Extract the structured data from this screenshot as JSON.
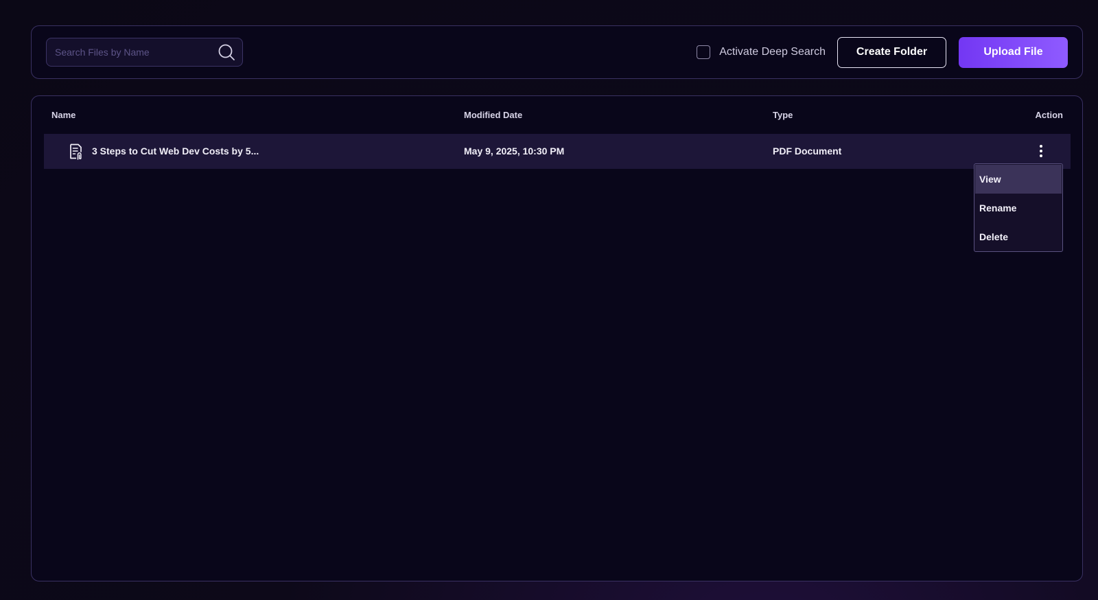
{
  "toolbar": {
    "search_placeholder": "Search Files by Name",
    "deep_search_label": "Activate Deep Search",
    "deep_search_checked": false,
    "create_folder_label": "Create Folder",
    "upload_file_label": "Upload File"
  },
  "table": {
    "headers": {
      "name": "Name",
      "modified": "Modified Date",
      "type": "Type",
      "action": "Action"
    },
    "rows": [
      {
        "icon": "document-icon",
        "name": "3 Steps to Cut Web Dev Costs by 5...",
        "modified": "May 9, 2025, 10:30 PM",
        "type": "PDF Document"
      }
    ]
  },
  "action_menu": {
    "items": [
      "View",
      "Rename",
      "Delete"
    ],
    "highlighted": "View"
  },
  "colors": {
    "accent": "#7c45f5",
    "panel_border": "#3a3163",
    "row_bg": "#1d1638",
    "menu_highlight": "#3b3359"
  }
}
